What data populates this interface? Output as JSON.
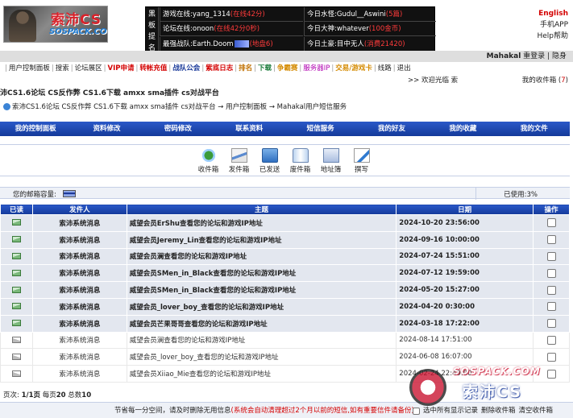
{
  "header": {
    "logo_text": "索沛CS",
    "logo_sub": "SOSPACK.COM",
    "board_side_label": [
      "黑",
      "板",
      "提",
      "名"
    ],
    "board": [
      {
        "label": "游戏在线:yang_1314",
        "value": "(在线42分)"
      },
      {
        "label": "今日水怪:Gudul__Aswini",
        "value": "(5篇)"
      },
      {
        "label": "论坛在线:onoon",
        "value": "(在线42分0秒)"
      },
      {
        "label": "今日大神:whatever",
        "value": "(100金币)"
      },
      {
        "label": "最强战队:Earth.Doom",
        "value": "(地盘6)"
      },
      {
        "label": "今日土豪:目中无人",
        "value": "(消费21420)"
      }
    ],
    "lang": "English",
    "app": "手机APP",
    "help": "Help帮助"
  },
  "userbar": {
    "user": "Mahakal",
    "login": "重登录",
    "sep": "|",
    "hide": "隐身"
  },
  "nav": [
    {
      "label": "用户控制面板",
      "color": "#222",
      "bold": false
    },
    {
      "label": "搜索",
      "color": "#222",
      "bold": false
    },
    {
      "label": "论坛展区",
      "color": "#222",
      "bold": false
    },
    {
      "label": "VIP申请",
      "color": "#d40000",
      "bold": true
    },
    {
      "label": "转帐充值",
      "color": "#d40000",
      "bold": true
    },
    {
      "label": "战队公会",
      "color": "#1a3a9a",
      "bold": true
    },
    {
      "label": "紫底日志",
      "color": "#d40000",
      "bold": true
    },
    {
      "label": "排名",
      "color": "#c07000",
      "bold": true
    },
    {
      "label": "下载",
      "color": "#1a7a3a",
      "bold": true
    },
    {
      "label": "争霸赛",
      "color": "#d48a00",
      "bold": true
    },
    {
      "label": "服务器IP",
      "color": "#b000b0",
      "bold": false
    },
    {
      "label": "交易/游戏卡",
      "color": "#d48a00",
      "bold": true
    },
    {
      "label": "线路",
      "color": "#222",
      "bold": false
    },
    {
      "label": "退出",
      "color": "#222",
      "bold": false
    }
  ],
  "welcome": ">> 欢迎光临 索",
  "mybox": {
    "label": "我的收件箱",
    "count": "7"
  },
  "site_title": "沛CS1.6论坛 CS反作弊 CS1.6下载 amxx sma插件 cs对战平台",
  "breadcrumb": "索沛CS1.6论坛 CS反作弊 CS1.6下载 amxx sma插件 cs对战平台 → 用户控制面板 → Mahakal用户短信服务",
  "tabs": [
    "我的控制面板",
    "资料修改",
    "密码修改",
    "联系资料",
    "短信服务",
    "我的好友",
    "我的收藏",
    "我的文件"
  ],
  "tools": [
    {
      "label": "收件箱",
      "icon": "inbox-icon",
      "cls": "ic-in"
    },
    {
      "label": "发件箱",
      "icon": "outbox-icon",
      "cls": "ic-out"
    },
    {
      "label": "已发送",
      "icon": "sent-icon",
      "cls": "ic-sent"
    },
    {
      "label": "废件箱",
      "icon": "trash-icon",
      "cls": "ic-trash"
    },
    {
      "label": "地址簿",
      "icon": "address-book-icon",
      "cls": "ic-addr"
    },
    {
      "label": "撰写",
      "icon": "compose-icon",
      "cls": "ic-write"
    }
  ],
  "capacity": {
    "label": "您的邮箱容量:",
    "used": "已使用:3%",
    "percent": 3
  },
  "table": {
    "headers": [
      "已读",
      "发件人",
      "主题",
      "日期",
      "操作"
    ],
    "rows": [
      {
        "read": false,
        "from": "索沛系统消息",
        "subject": "威望会员ErShu查看您的论坛和游戏IP地址",
        "date": "2024-10-20 23:56:00"
      },
      {
        "read": false,
        "from": "索沛系统消息",
        "subject": "威望会员Jeremy_Lin查看您的论坛和游戏IP地址",
        "date": "2024-09-16 10:00:00"
      },
      {
        "read": false,
        "from": "索沛系统消息",
        "subject": "威望会员澜查看您的论坛和游戏IP地址",
        "date": "2024-07-24 15:51:00"
      },
      {
        "read": false,
        "from": "索沛系统消息",
        "subject": "威望会员SMen_in_Black查看您的论坛和游戏IP地址",
        "date": "2024-07-12 19:59:00"
      },
      {
        "read": false,
        "from": "索沛系统消息",
        "subject": "威望会员SMen_in_Black查看您的论坛和游戏IP地址",
        "date": "2024-05-20 15:27:00"
      },
      {
        "read": false,
        "from": "索沛系统消息",
        "subject": "威望会员_lover_boy_查看您的论坛和游戏IP地址",
        "date": "2024-04-20 0:30:00"
      },
      {
        "read": false,
        "from": "索沛系统消息",
        "subject": "威望会员芒果哥哥查看您的论坛和游戏IP地址",
        "date": "2024-03-18 17:22:00"
      },
      {
        "read": true,
        "from": "索沛系统消息",
        "subject": "威望会员澜查看您的论坛和游戏IP地址",
        "date": "2024-08-14 17:51:00"
      },
      {
        "read": true,
        "from": "索沛系统消息",
        "subject": "威望会员_lover_boy_查看您的论坛和游戏IP地址",
        "date": "2024-06-08 16:07:00"
      },
      {
        "read": true,
        "from": "索沛系统消息",
        "subject": "威望会员Xiiao_Mie查看您的论坛和游戏IP地址",
        "date": "2024-02-24 22:49:00"
      }
    ]
  },
  "pager": {
    "page_label": "页次:",
    "page": "1/1页",
    "per_label": "每页",
    "per": "20",
    "total_label": "总数",
    "total": "10"
  },
  "footer": {
    "tip": "节省每一分空间，请及时删除无用信息",
    "warn": "(系统会自动清理超过2个月以前的短信,如有重要信件请备份)",
    "select_all": "选中所有显示记录",
    "delete_btn": "删除收件箱",
    "clear_btn": "清空收件箱"
  },
  "watermark": {
    "line1": "SOSPACK.COM",
    "line2": "索沛CS"
  }
}
